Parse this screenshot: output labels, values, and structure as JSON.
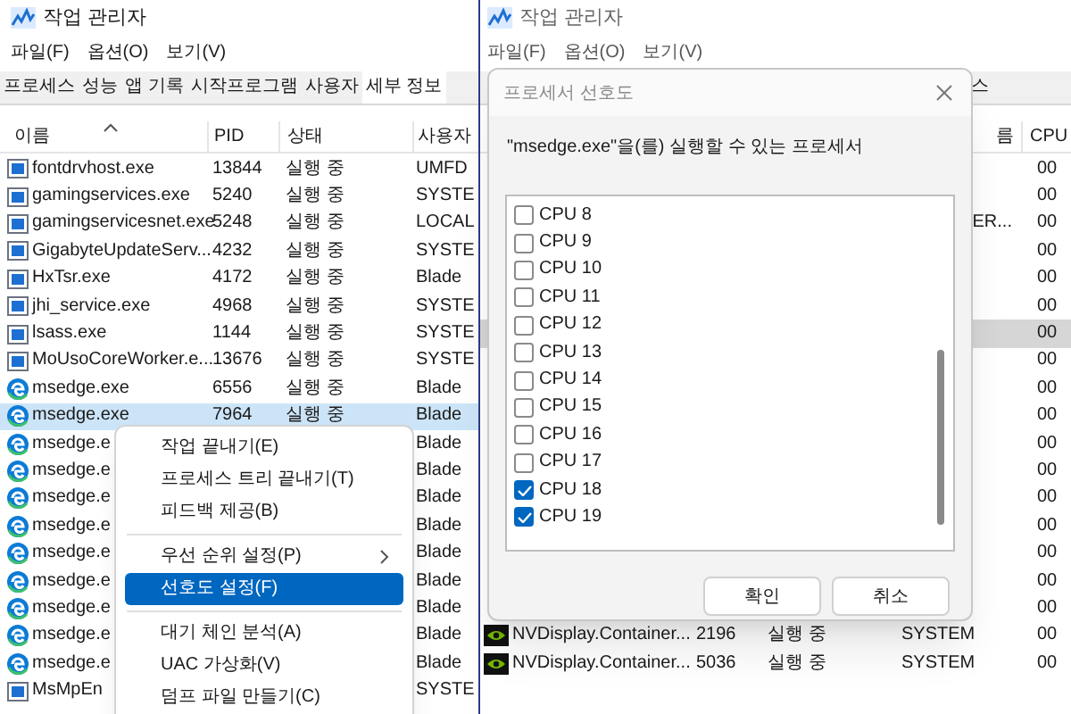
{
  "left_window": {
    "title": "작업 관리자",
    "menu": [
      "파일(F)",
      "옵션(O)",
      "보기(V)"
    ],
    "tabs": [
      {
        "label": "프로세스",
        "selected": false
      },
      {
        "label": "성능",
        "selected": false
      },
      {
        "label": "앱 기록",
        "selected": false
      },
      {
        "label": "시작프로그램",
        "selected": false
      },
      {
        "label": "사용자",
        "selected": false
      },
      {
        "label": "세부 정보",
        "selected": true
      }
    ],
    "columns": [
      "이름",
      "PID",
      "상태",
      "사용자"
    ],
    "rows": [
      {
        "kind": "app",
        "name": "fontdrvhost.exe",
        "pid": "13844",
        "status": "실행 중",
        "user": "UMFD",
        "selected": false
      },
      {
        "kind": "app",
        "name": "gamingservices.exe",
        "pid": "5240",
        "status": "실행 중",
        "user": "SYSTE",
        "selected": false
      },
      {
        "kind": "app",
        "name": "gamingservicesnet.exe",
        "pid": "5248",
        "status": "실행 중",
        "user": "LOCAL",
        "selected": false
      },
      {
        "kind": "app",
        "name": "GigabyteUpdateServ...",
        "pid": "4232",
        "status": "실행 중",
        "user": "SYSTE",
        "selected": false
      },
      {
        "kind": "app",
        "name": "HxTsr.exe",
        "pid": "4172",
        "status": "실행 중",
        "user": "Blade",
        "selected": false
      },
      {
        "kind": "app",
        "name": "jhi_service.exe",
        "pid": "4968",
        "status": "실행 중",
        "user": "SYSTE",
        "selected": false
      },
      {
        "kind": "app",
        "name": "lsass.exe",
        "pid": "1144",
        "status": "실행 중",
        "user": "SYSTE",
        "selected": false
      },
      {
        "kind": "app",
        "name": "MoUsoCoreWorker.e...",
        "pid": "13676",
        "status": "실행 중",
        "user": "SYSTE",
        "selected": false
      },
      {
        "kind": "edge",
        "name": "msedge.exe",
        "pid": "6556",
        "status": "실행 중",
        "user": "Blade",
        "selected": false
      },
      {
        "kind": "edge",
        "name": "msedge.exe",
        "pid": "7964",
        "status": "실행 중",
        "user": "Blade",
        "selected": true
      },
      {
        "kind": "edge",
        "name": "msedge.e",
        "user": "Blade",
        "selected": false
      },
      {
        "kind": "edge",
        "name": "msedge.e",
        "user": "Blade",
        "selected": false
      },
      {
        "kind": "edge",
        "name": "msedge.e",
        "user": "Blade",
        "selected": false
      },
      {
        "kind": "edge",
        "name": "msedge.e",
        "user": "Blade",
        "selected": false
      },
      {
        "kind": "edge",
        "name": "msedge.e",
        "user": "Blade",
        "selected": false
      },
      {
        "kind": "edge",
        "name": "msedge.e",
        "user": "Blade",
        "selected": false
      },
      {
        "kind": "edge",
        "name": "msedge.e",
        "user": "Blade",
        "selected": false
      },
      {
        "kind": "edge",
        "name": "msedge.e",
        "user": "Blade",
        "selected": false
      },
      {
        "kind": "edge",
        "name": "msedge.e",
        "user": "Blade",
        "selected": false
      },
      {
        "kind": "app",
        "name": "MsMpEn",
        "user": "SYSTE",
        "selected": false
      }
    ]
  },
  "context_menu": {
    "items": [
      {
        "kind": "item",
        "label": "작업 끝내기(E)",
        "submenu": false,
        "selected": false
      },
      {
        "kind": "item",
        "label": "프로세스 트리 끝내기(T)",
        "submenu": false,
        "selected": false
      },
      {
        "kind": "item",
        "label": "피드백 제공(B)",
        "submenu": false,
        "selected": false
      },
      {
        "kind": "separator"
      },
      {
        "kind": "item",
        "label": "우선 순위 설정(P)",
        "submenu": true,
        "selected": false
      },
      {
        "kind": "item",
        "label": "선호도 설정(F)",
        "submenu": false,
        "selected": true
      },
      {
        "kind": "separator"
      },
      {
        "kind": "item",
        "label": "대기 체인 분석(A)",
        "submenu": false,
        "selected": false
      },
      {
        "kind": "item",
        "label": "UAC 가상화(V)",
        "submenu": false,
        "selected": false
      },
      {
        "kind": "item",
        "label": "덤프 파일 만들기(C)",
        "submenu": false,
        "selected": false
      }
    ]
  },
  "right_window": {
    "title": "작업 관리자",
    "menu": [
      "파일(F)",
      "옵션(O)",
      "보기(V)"
    ],
    "tabs": [
      {
        "label": "스",
        "selected": false
      }
    ],
    "columns": [
      "름",
      "CPU"
    ],
    "rows": [
      {
        "cpu": "00",
        "selected": false
      },
      {
        "cpu": "00",
        "selected": false
      },
      {
        "user": "ER...",
        "cpu": "00",
        "selected": false
      },
      {
        "cpu": "00",
        "selected": false
      },
      {
        "cpu": "00",
        "selected": false
      },
      {
        "cpu": "00",
        "selected": false
      },
      {
        "cpu": "00",
        "selected": true
      },
      {
        "cpu": "00",
        "selected": false
      },
      {
        "cpu": "00",
        "selected": false
      },
      {
        "cpu": "00",
        "selected": false
      },
      {
        "cpu": "00",
        "selected": false
      },
      {
        "cpu": "00",
        "selected": false
      },
      {
        "cpu": "00",
        "selected": false
      },
      {
        "cpu": "00",
        "selected": false
      },
      {
        "cpu": "00",
        "selected": false
      },
      {
        "cpu": "00",
        "selected": false
      },
      {
        "cpu": "00",
        "selected": false
      },
      {
        "kind": "nvidia",
        "name": "NVDisplay.Container...",
        "pid": "2196",
        "status": "실행 중",
        "user": "SYSTEM",
        "cpu": "00",
        "selected": false
      },
      {
        "kind": "nvidia",
        "name": "NVDisplay.Container...",
        "pid": "5036",
        "status": "실행 중",
        "user": "SYSTEM",
        "cpu": "00",
        "selected": false
      }
    ]
  },
  "dialog": {
    "title": "프로세서 선호도",
    "prompt": "\"msedge.exe\"을(를) 실행할 수 있는 프로세서",
    "cpus": [
      {
        "label": "CPU 8",
        "checked": false
      },
      {
        "label": "CPU 9",
        "checked": false
      },
      {
        "label": "CPU 10",
        "checked": false
      },
      {
        "label": "CPU 11",
        "checked": false
      },
      {
        "label": "CPU 12",
        "checked": false
      },
      {
        "label": "CPU 13",
        "checked": false
      },
      {
        "label": "CPU 14",
        "checked": false
      },
      {
        "label": "CPU 15",
        "checked": false
      },
      {
        "label": "CPU 16",
        "checked": false
      },
      {
        "label": "CPU 17",
        "checked": false
      },
      {
        "label": "CPU 18",
        "checked": true
      },
      {
        "label": "CPU 19",
        "checked": true
      }
    ],
    "buttons": [
      "확인",
      "취소"
    ]
  }
}
